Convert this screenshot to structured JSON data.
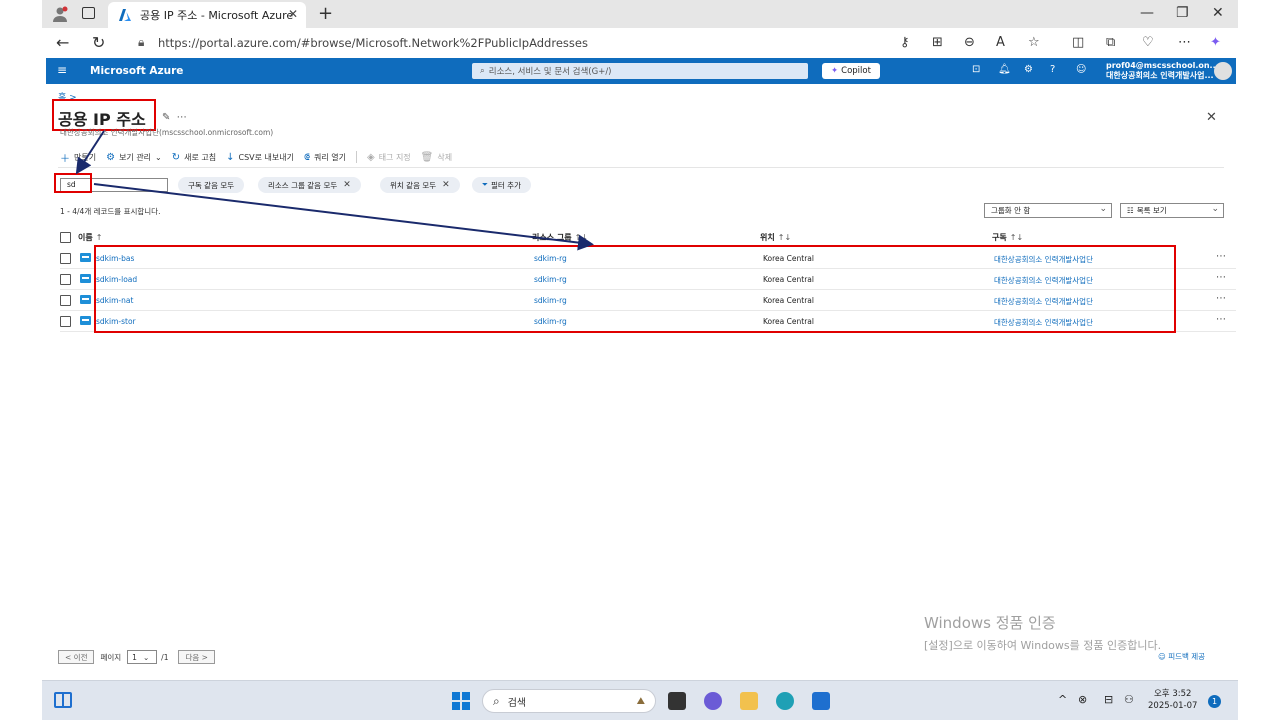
{
  "browser": {
    "tab_title": "공용 IP 주소 - Microsoft Azure",
    "url": "https://portal.azure.com/#browse/Microsoft.Network%2FPublicIpAddresses"
  },
  "azure_header": {
    "brand": "Microsoft Azure",
    "search_placeholder": "리소스, 서비스 및 문서 검색(G+/)",
    "copilot": "Copilot",
    "account_email": "prof04@mscsschool.on...",
    "account_org": "대한상공회의소 인력개발사업..."
  },
  "page": {
    "breadcrumb": "홈 >",
    "title": "공용 IP 주소",
    "subtitle": "대한상공회의소 인력개발사업단(mscsschool.onmicrosoft.com)"
  },
  "toolbar": {
    "create": "만들기",
    "manage_view": "보기 관리",
    "refresh": "새로 고침",
    "export_csv": "CSV로 내보내기",
    "open_query": "쿼리 열기",
    "assign_tags": "태그 지정",
    "delete": "삭제"
  },
  "filters": {
    "search_value": "sd",
    "subscription": "구독 같음 모두",
    "resource_group": "리소스 그룹 같음 모두",
    "location": "위치 같음 모두",
    "add_filter": "필터 추가"
  },
  "records_info": "1 - 4/4개 레코드를 표시합니다.",
  "grouping": "그룹화 안 함",
  "view_mode": "목록 보기",
  "columns": {
    "name": "이름",
    "resource_group": "리소스 그룹",
    "location": "위치",
    "subscription": "구독"
  },
  "rows": [
    {
      "name": "sdkim-bas",
      "resource_group": "sdkim-rg",
      "location": "Korea Central",
      "subscription": "대한상공회의소 인력개발사업단"
    },
    {
      "name": "sdkim-load",
      "resource_group": "sdkim-rg",
      "location": "Korea Central",
      "subscription": "대한상공회의소 인력개발사업단"
    },
    {
      "name": "sdkim-nat",
      "resource_group": "sdkim-rg",
      "location": "Korea Central",
      "subscription": "대한상공회의소 인력개발사업단"
    },
    {
      "name": "sdkim-stor",
      "resource_group": "sdkim-rg",
      "location": "Korea Central",
      "subscription": "대한상공회의소 인력개발사업단"
    }
  ],
  "pager": {
    "prev": "< 이전",
    "page_label": "페이지",
    "page_value": "1",
    "total": "/1",
    "next": "다음 >"
  },
  "feedback": "피드백 제공",
  "watermark": {
    "line1": "Windows 정품 인증",
    "line2": "[설정]으로 이동하여 Windows를 정품 인증합니다."
  },
  "taskbar": {
    "search": "검색",
    "time": "오후 3:52",
    "date": "2025-01-07",
    "notifications": "1"
  },
  "colors": {
    "azure_blue": "#0f6cbd",
    "highlight_red": "#e00000",
    "arrow_navy": "#1a2a6c"
  }
}
